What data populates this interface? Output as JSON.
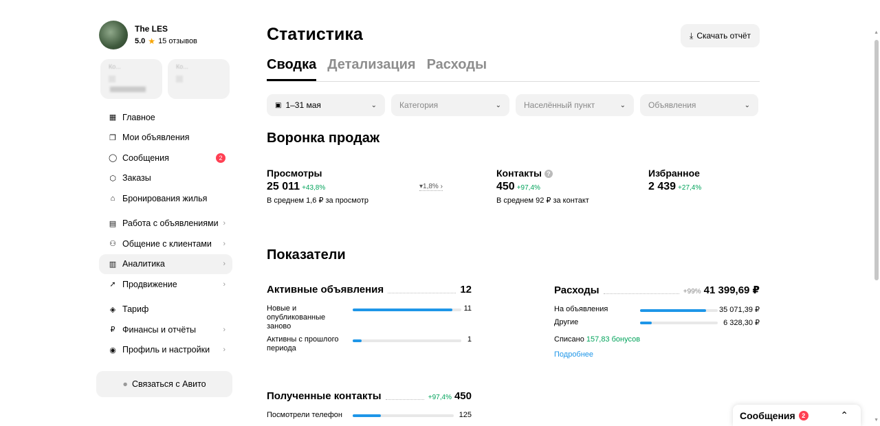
{
  "profile": {
    "name": "The LES",
    "rating": "5.0",
    "reviews": "15 отзывов"
  },
  "cards": [
    {
      "label": "Ко..."
    },
    {
      "label": "Ко..."
    }
  ],
  "nav": {
    "home": "Главное",
    "my_ads": "Мои объявления",
    "messages": "Сообщения",
    "messages_badge": "2",
    "orders": "Заказы",
    "bookings": "Бронирования жилья",
    "work_ads": "Работа с объявлениями",
    "clients": "Общение с клиентами",
    "analytics": "Аналитика",
    "promotion": "Продвижение",
    "tariff": "Тариф",
    "finance": "Финансы и отчёты",
    "profile": "Профиль и настройки"
  },
  "contact_avito": "Связаться с Авито",
  "page": {
    "title": "Статистика",
    "download": "Скачать отчёт",
    "tabs": [
      "Сводка",
      "Детализация",
      "Расходы"
    ]
  },
  "filters": {
    "period": "1–31 мая",
    "category": "Категория",
    "locality": "Населённый пункт",
    "ads": "Объявления"
  },
  "funnel": {
    "title": "Воронка продаж",
    "views": {
      "label": "Просмотры",
      "value": "25 011",
      "delta": "+43,8%",
      "sub": "В среднем 1,6 ₽ за просмотр"
    },
    "conversion": "1,8%",
    "contacts": {
      "label": "Контакты",
      "value": "450",
      "delta": "+97,4%",
      "sub": "В среднем 92 ₽ за контакт"
    },
    "favorites": {
      "label": "Избранное",
      "value": "2 439",
      "delta": "+27,4%"
    }
  },
  "indicators": {
    "title": "Показатели",
    "active": {
      "label": "Активные объявления",
      "value": "12",
      "rows": [
        {
          "label": "Новые и опубликованные заново",
          "value": "11",
          "fraction": 0.92
        },
        {
          "label": "Активны с прошлого периода",
          "value": "1",
          "fraction": 0.08
        }
      ]
    },
    "expenses": {
      "label": "Расходы",
      "delta": "+99%",
      "value": "41 399,69 ₽",
      "rows": [
        {
          "label": "На объявления",
          "value": "35 071,39 ₽",
          "fraction": 0.85
        },
        {
          "label": "Другие",
          "value": "6 328,30 ₽",
          "fraction": 0.15
        }
      ],
      "written_off": "Списано",
      "bonuses": "157,83 бонусов",
      "more": "Подробнее"
    },
    "contacts": {
      "label": "Полученные контакты",
      "delta": "+97,4%",
      "value": "450",
      "rows": [
        {
          "label": "Посмотрели телефон",
          "value": "125",
          "fraction": 0.28
        }
      ]
    }
  },
  "messenger": {
    "label": "Сообщения",
    "badge": "2"
  }
}
